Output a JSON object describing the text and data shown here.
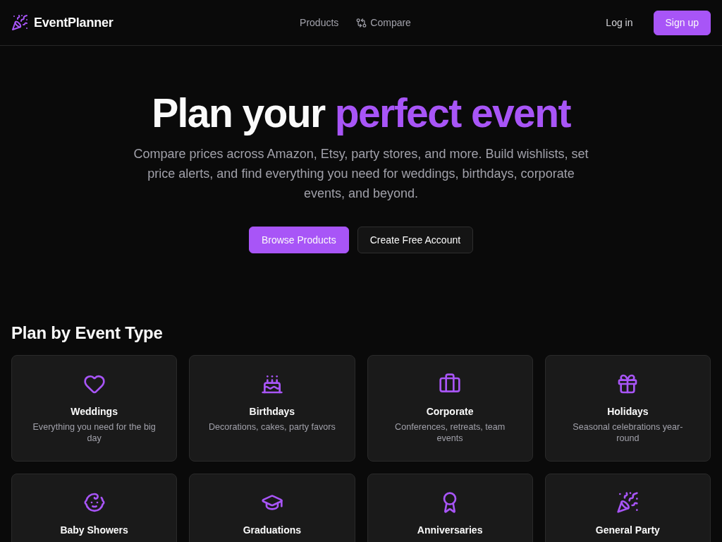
{
  "header": {
    "brand": "EventPlanner",
    "nav": [
      {
        "label": "Products"
      },
      {
        "label": "Compare"
      }
    ],
    "actions": [
      {
        "label": "Log in",
        "kind": "ghost"
      },
      {
        "label": "Sign up",
        "kind": "primary"
      }
    ]
  },
  "hero": {
    "title_parts": [
      {
        "text": "Plan your",
        "accent": false
      },
      {
        "text": "perfect event",
        "accent": true
      }
    ],
    "subtitle": "Compare prices across Amazon, Etsy, party stores, and more. Build wishlists, set price alerts, and find everything you need for weddings, birthdays, corporate events, and beyond.",
    "buttons": [
      {
        "label": "Browse Products",
        "kind": "primary"
      },
      {
        "label": "Create Free Account",
        "kind": "outline"
      }
    ]
  },
  "event_types": {
    "heading": "Plan by Event Type",
    "cards": [
      {
        "title": "Weddings",
        "description": "Everything you need for the big day"
      },
      {
        "title": "Birthdays",
        "description": "Decorations, cakes, party favors"
      },
      {
        "title": "Corporate",
        "description": "Conferences, retreats, team events"
      },
      {
        "title": "Holidays",
        "description": "Seasonal celebrations year-round"
      },
      {
        "title": "Baby Showers"
      },
      {
        "title": "Graduations"
      },
      {
        "title": "Anniversaries"
      },
      {
        "title": "General Party"
      }
    ]
  }
}
